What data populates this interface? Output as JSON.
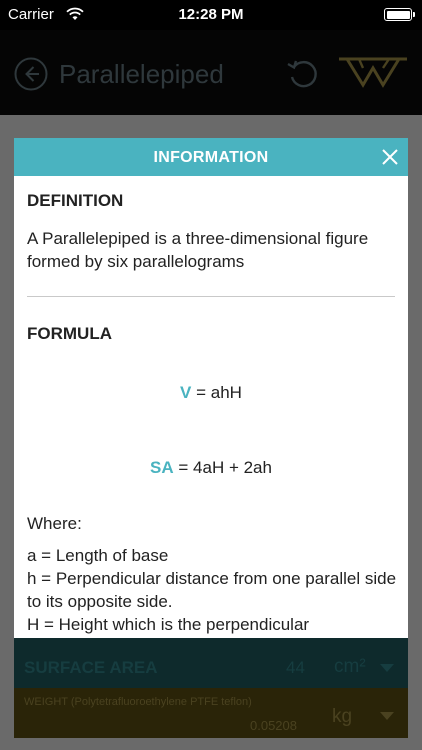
{
  "status_bar": {
    "carrier": "Carrier",
    "time": "12:28 PM"
  },
  "header": {
    "title": "Parallelepiped"
  },
  "modal": {
    "title": "INFORMATION",
    "definition_heading": "DEFINITION",
    "definition_text": "A Parallelepiped is a three-dimensional figure formed by six parallelograms",
    "formula_heading": "FORMULA",
    "formula_v_symbol": "V",
    "formula_v_expr": " = ahH",
    "formula_sa_symbol": "SA",
    "formula_sa_expr": " = 4aH + 2ah",
    "where_label": "Where:",
    "definitions": [
      "a = Length of base",
      "h = Perpendicular distance from one parallel side to its opposite side.",
      "H = Height which is the perpendicular"
    ]
  },
  "surface_row": {
    "label": "SURFACE AREA",
    "value": "44",
    "unit": "cm²"
  },
  "weight_row": {
    "label": "WEIGHT (Polytetrafluoroethylene PTFE teflon)",
    "value": "0.05208",
    "unit": "kg"
  },
  "colors": {
    "accent": "#4ab3c0",
    "status_bar": "#000000"
  },
  "icons": [
    "wifi-icon",
    "battery-icon",
    "back-icon",
    "reset-icon",
    "logo",
    "close-icon",
    "chevron-down-icon"
  ]
}
